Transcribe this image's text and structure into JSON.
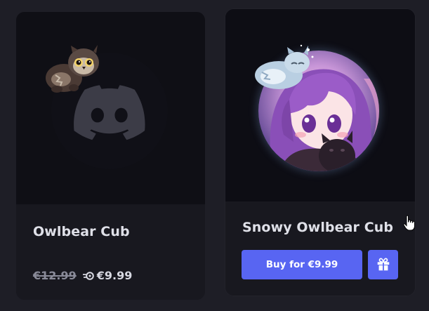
{
  "colors": {
    "background": "#1e1e26",
    "card": "#18181f",
    "preview_bg": "#0f0f15",
    "accent": "#5865f2",
    "title_text": "#dfe0e8",
    "muted_text": "#8a8b99"
  },
  "cards": [
    {
      "title": "Owlbear Cub",
      "preview_icon": "discord-logo-icon",
      "decoration": "owlbear-cub-sticker",
      "price_original": "€12.99",
      "price_discount_icon": "nitro-icon",
      "price_nitro": "€9.99"
    },
    {
      "title": "Snowy Owlbear Cub",
      "preview_image": "anime-avatar",
      "decoration": "snowy-owlbear-cub-sticker",
      "buy_label": "Buy for €9.99",
      "gift_icon": "gift-icon"
    }
  ],
  "cursor": "hand-pointer-icon"
}
